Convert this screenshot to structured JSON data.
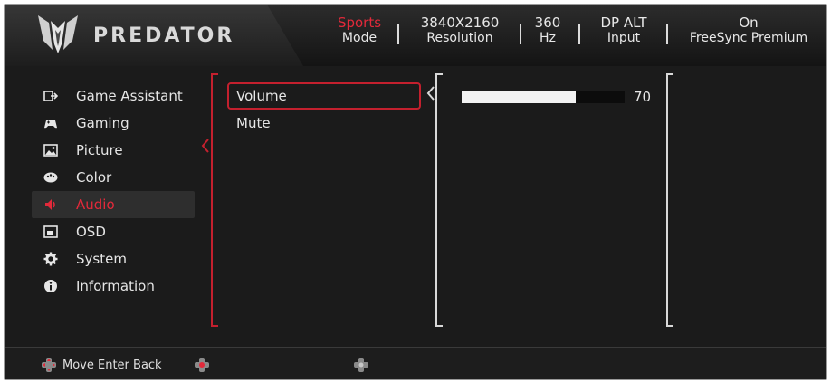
{
  "brand": {
    "name": "PREDATOR"
  },
  "status": [
    {
      "value": "Sports",
      "label": "Mode",
      "accent": true
    },
    {
      "value": "3840X2160",
      "label": "Resolution",
      "accent": false
    },
    {
      "value": "360",
      "label": "Hz",
      "accent": false
    },
    {
      "value": "DP ALT",
      "label": "Input",
      "accent": false
    },
    {
      "value": "On",
      "label": "FreeSync Premium",
      "accent": false
    }
  ],
  "menu": {
    "categories": [
      {
        "label": "Game Assistant",
        "icon": "game-assistant-icon"
      },
      {
        "label": "Gaming",
        "icon": "gamepad-icon"
      },
      {
        "label": "Picture",
        "icon": "picture-icon"
      },
      {
        "label": "Color",
        "icon": "palette-icon"
      },
      {
        "label": "Audio",
        "icon": "speaker-icon",
        "active": true
      },
      {
        "label": "OSD",
        "icon": "osd-icon"
      },
      {
        "label": "System",
        "icon": "gear-icon"
      },
      {
        "label": "Information",
        "icon": "info-icon"
      }
    ],
    "audio_items": [
      {
        "label": "Volume",
        "selected": true
      },
      {
        "label": "Mute"
      }
    ],
    "volume": {
      "value": "70",
      "max": "100"
    }
  },
  "footer": {
    "hint": "Move Enter Back"
  },
  "colors": {
    "accent": "#e2293a",
    "panel": "#1b1b1b",
    "bracket": "#c4202e"
  }
}
